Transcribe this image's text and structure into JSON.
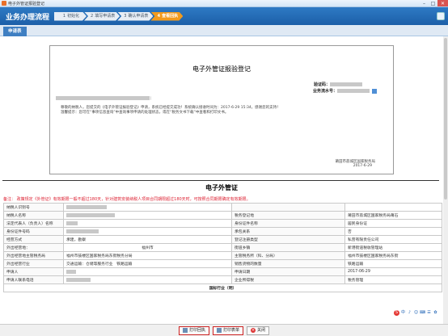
{
  "window": {
    "title": "电子外管证报验登记"
  },
  "header": {
    "label": "业务办理流程",
    "steps": [
      {
        "num": "1",
        "label": "初始化"
      },
      {
        "num": "2",
        "label": "填写申请表"
      },
      {
        "num": "3",
        "label": "确认申请表"
      },
      {
        "num": "4",
        "label": "查看回执"
      }
    ]
  },
  "tabbar": {
    "tab": "申请表"
  },
  "notice": {
    "title": "电子外管证报验登记",
    "checkcode_label": "验证码：",
    "serial_label": "业务流水号：",
    "salute_suffix": "：",
    "p1": "尊敬的纳税人，您提交的《电子外管证报验登记》申请，系统已经提交成功！系统确认接收时间为：2017-6-29 15:34，感谢您的支持！",
    "p2": "温馨提示：您可在“事项信息查询”中查询事项申请的处理状态，或在“税务文书下载”中查看和打印文书。",
    "org": "莆田市荔城区国家税务局",
    "date": "2017-6-29"
  },
  "certificate": {
    "title": "电子外管证",
    "remark": "备注：  政策规定《外管证》有效期限一般不超过180天，针对建筑安装纳税人项目合同期限超过180天时，可按照合同期限确定有效期限。",
    "rows": [
      [
        {
          "l": "纳税人识别号",
          "v": ""
        },
        {
          "l": "",
          "v": ""
        }
      ],
      [
        {
          "l": "纳税人名称",
          "v": ""
        },
        {
          "l": "税务登记地",
          "v": "莆田市荔城区国家税务局莆石"
        }
      ],
      [
        {
          "l": "法定代表人（负责人）名称",
          "v": ""
        },
        {
          "l": "身份证件名称",
          "v": "居民身份证"
        }
      ],
      [
        {
          "l": "身份证件号码",
          "v": ""
        },
        {
          "l": "承包关系",
          "v": "否"
        }
      ],
      [
        {
          "l": "经营方式",
          "v": "承建，勘察"
        },
        {
          "l": "登记注册类型",
          "v": "私营有限责任公司"
        }
      ],
      [
        {
          "l": "外出经营地：",
          "v": "福州市"
        },
        {
          "l": "街道乡镇",
          "v": "新港街道税收管理站"
        }
      ],
      [
        {
          "l": "外出经营地主管税务局",
          "v": "福州市鼓楼区国家税务局东街税务分局"
        },
        {
          "l": "主管税务所（科、分局）",
          "v": "福州市鼓楼区国家税务局东街"
        }
      ],
      [
        {
          "l": "外出经营行业",
          "v": "交通运输：仓储等服务行业"
        },
        {
          "l": "销售货物的数量",
          "v": "0"
        }
      ],
      [
        {
          "l": "申请人",
          "v": ""
        },
        {
          "l": "申请日期",
          "v": "2017-06-29"
        }
      ],
      [
        {
          "l": "申请人联系电话",
          "v": ""
        },
        {
          "l": "企业所得税",
          "v": "税务管理"
        }
      ]
    ],
    "row8_extra": {
      "a": "铁路运输",
      "b": "铁路运输"
    },
    "section": "国标行业（明）"
  },
  "toolbar": {
    "print_notice": "打印回执",
    "print_form": "打印表单",
    "close": "关闭"
  },
  "colors": {
    "header": "#1c5fa8",
    "active_step": "#f29a1c",
    "remark": "#d22233"
  },
  "icons": [
    "app-icon",
    "minimize-icon",
    "maximize-icon",
    "close-icon",
    "print-icon",
    "copy-icon",
    "sogou-ime-icon"
  ]
}
